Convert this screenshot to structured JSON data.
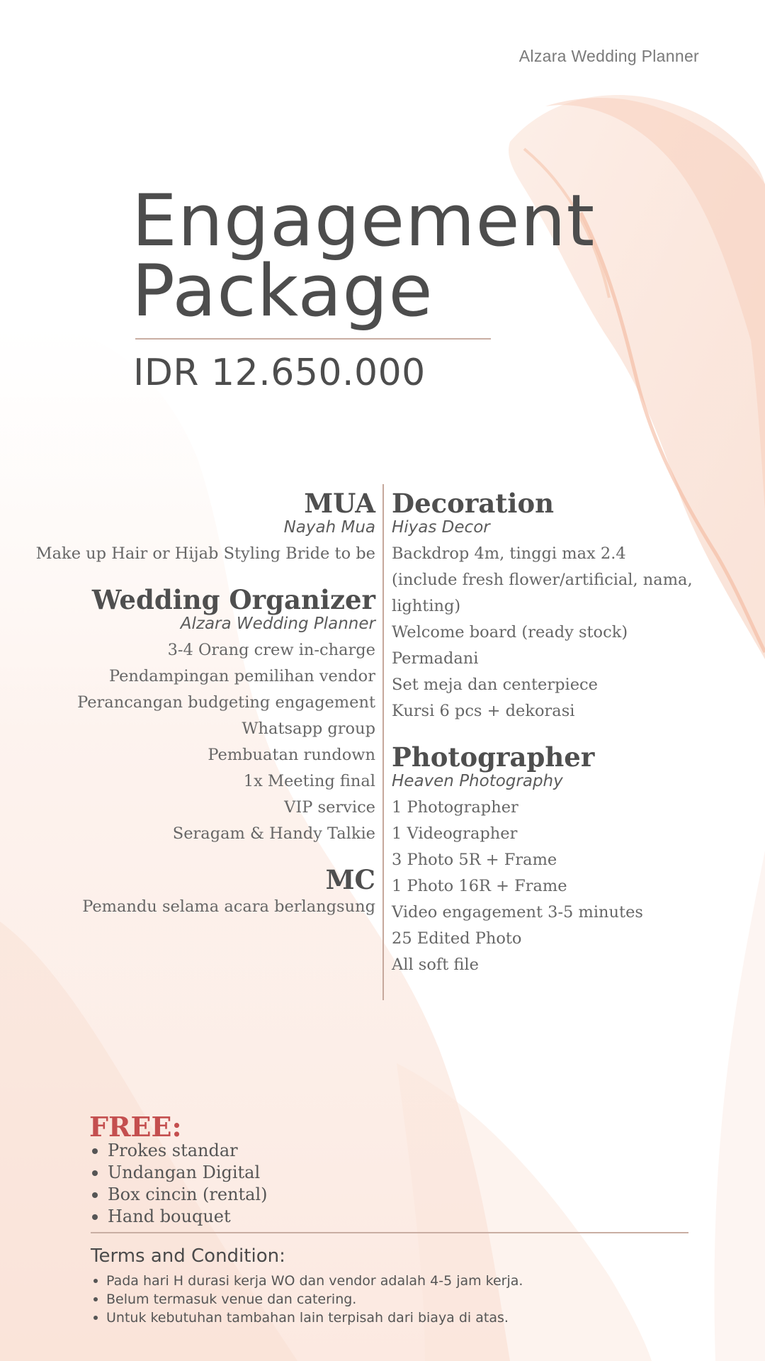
{
  "header": {
    "brand": "Alzara Wedding Planner"
  },
  "title": {
    "line1": "Engagement",
    "line2": "Package"
  },
  "price": "IDR 12.650.000",
  "left_column": {
    "mua": {
      "title": "MUA",
      "vendor": "Nayah Mua",
      "items": [
        "Make up Hair or Hijab Styling Bride to be"
      ]
    },
    "wedding_organizer": {
      "title": "Wedding Organizer",
      "vendor": "Alzara Wedding Planner",
      "items": [
        "3-4 Orang crew in-charge",
        "Pendampingan pemilihan vendor",
        "Perancangan budgeting engagement",
        "Whatsapp group",
        "Pembuatan rundown",
        "1x Meeting final",
        "VIP service",
        "Seragam & Handy Talkie"
      ]
    },
    "mc": {
      "title": "MC",
      "items": [
        "Pemandu selama acara berlangsung"
      ]
    }
  },
  "right_column": {
    "decoration": {
      "title": "Decoration",
      "vendor": "Hiyas Decor",
      "items": [
        "Backdrop 4m, tinggi max 2.4",
        "(include fresh flower/artificial, nama,",
        "lighting)",
        "Welcome board (ready stock)",
        "Permadani",
        "Set meja dan centerpiece",
        "Kursi 6 pcs + dekorasi"
      ]
    },
    "photographer": {
      "title": "Photographer",
      "vendor": "Heaven Photography",
      "items": [
        "1 Photographer",
        "1 Videographer",
        "3 Photo 5R + Frame",
        "1 Photo 16R + Frame",
        "Video engagement 3-5 minutes",
        "25 Edited Photo",
        "All soft file"
      ]
    }
  },
  "free": {
    "title": "FREE:",
    "items": [
      "Prokes standar",
      "Undangan Digital",
      "Box cincin (rental)",
      "Hand bouquet"
    ]
  },
  "terms": {
    "title": "Terms and Condition:",
    "items": [
      "Pada hari H durasi kerja WO dan vendor adalah 4-5 jam kerja.",
      "Belum termasuk venue dan catering.",
      "Untuk kebutuhan tambahan lain terpisah dari biaya di atas."
    ]
  },
  "colors": {
    "accent": "#c44f4f",
    "text": "#555555",
    "rule": "#c9aea3",
    "silk": "#f6c9b4"
  }
}
